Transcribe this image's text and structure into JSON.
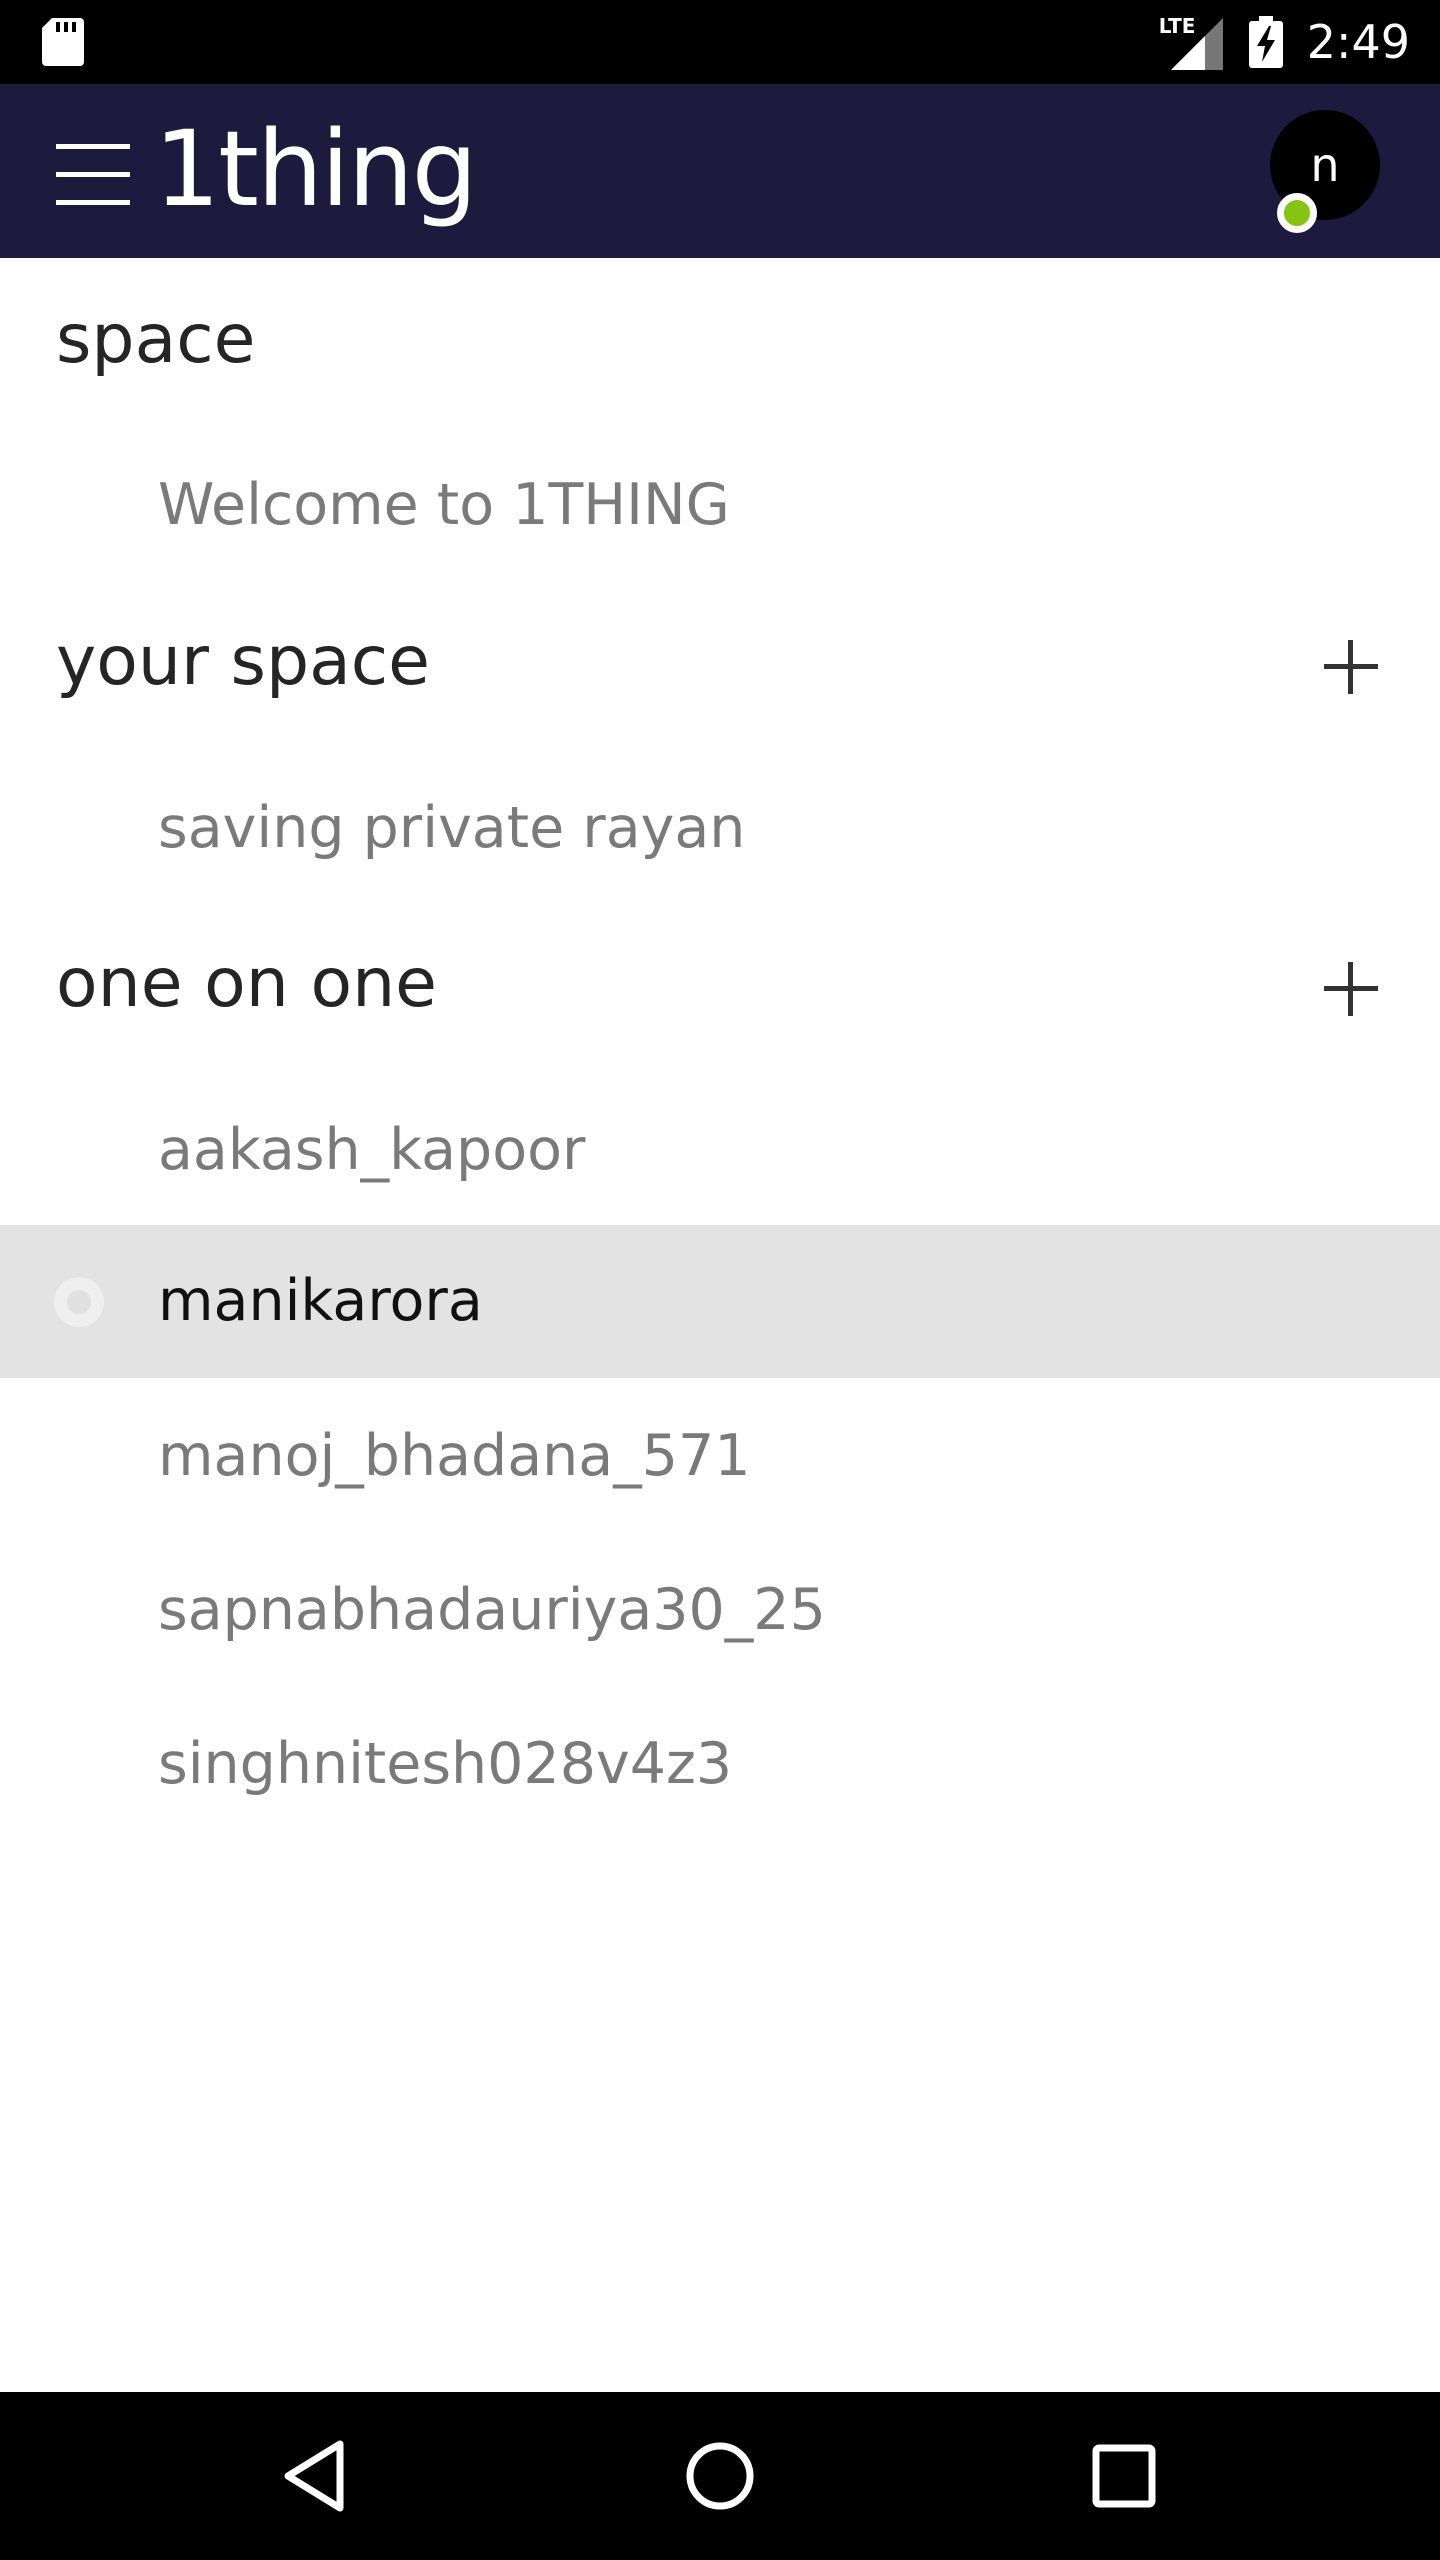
{
  "status_bar": {
    "time": "2:49",
    "network": "LTE",
    "icons": [
      "sd-card-icon",
      "lte-signal-icon",
      "battery-charging-icon"
    ]
  },
  "app_bar": {
    "title": "1thing",
    "avatar_initial": "n",
    "presence_color": "#85c410",
    "background": "#1e1a3d"
  },
  "sections": {
    "space": {
      "header": "space",
      "items": [
        "Welcome to 1THING"
      ]
    },
    "your_space": {
      "header": "your space",
      "items": [
        "saving private rayan"
      ]
    },
    "one_on_one": {
      "header": "one on one",
      "items": [
        "aakash_kapoor",
        "manikarora",
        "manoj_bhadana_571",
        "sapnabhadauriya30_25",
        "singhnitesh028v4z3"
      ],
      "selected": "manikarora"
    }
  },
  "nav_bar": {
    "buttons": [
      "back-icon",
      "home-icon",
      "recents-icon"
    ]
  }
}
